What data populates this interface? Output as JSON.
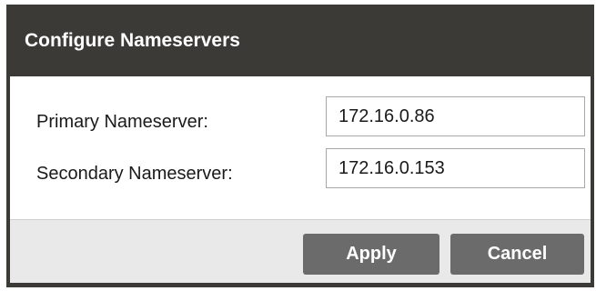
{
  "dialog": {
    "title": "Configure Nameservers"
  },
  "fields": {
    "primary": {
      "label": "Primary Nameserver:",
      "value": "172.16.0.86"
    },
    "secondary": {
      "label": "Secondary Nameserver:",
      "value": "172.16.0.153"
    }
  },
  "buttons": {
    "apply_label": "Apply",
    "cancel_label": "Cancel"
  },
  "colors": {
    "title_bar": "#3c3a37",
    "button": "#6b6b6b",
    "footer": "#e9e9e9"
  }
}
